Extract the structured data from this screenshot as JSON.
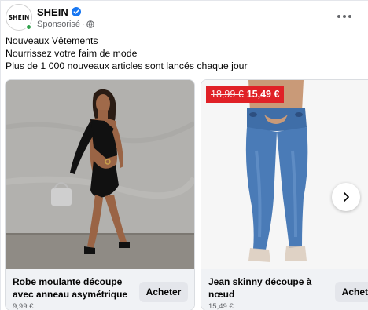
{
  "header": {
    "avatar_text": "SHEIN",
    "brand_name": "SHEIN",
    "sponsored": "Sponsorisé",
    "separator": "·",
    "verified_icon": "verified-badge-icon",
    "privacy_icon": "globe-icon",
    "more_icon": "more-options-icon"
  },
  "post": {
    "lines": [
      "Nouveaux Vêtements",
      "Nourrissez votre faim de mode",
      "Plus de 1 000 nouveaux articles sont lancés chaque jour"
    ]
  },
  "carousel": {
    "items": [
      {
        "title": "Robe moulante découpe avec anneau asymétrique",
        "price": "9,99 €",
        "button": "Acheter"
      },
      {
        "title": "Jean skinny découpe à nœud",
        "price": "15,49 €",
        "button": "Acheter",
        "badge_old_price": "18,99 €",
        "badge_new_price": "15,49 €"
      }
    ],
    "next_icon": "chevron-right-icon"
  },
  "colors": {
    "brand_blue": "#1877f2",
    "badge_red": "#e02127",
    "online_green": "#31a24c",
    "footer_gray": "#f0f2f5",
    "button_gray": "#e4e6eb"
  }
}
